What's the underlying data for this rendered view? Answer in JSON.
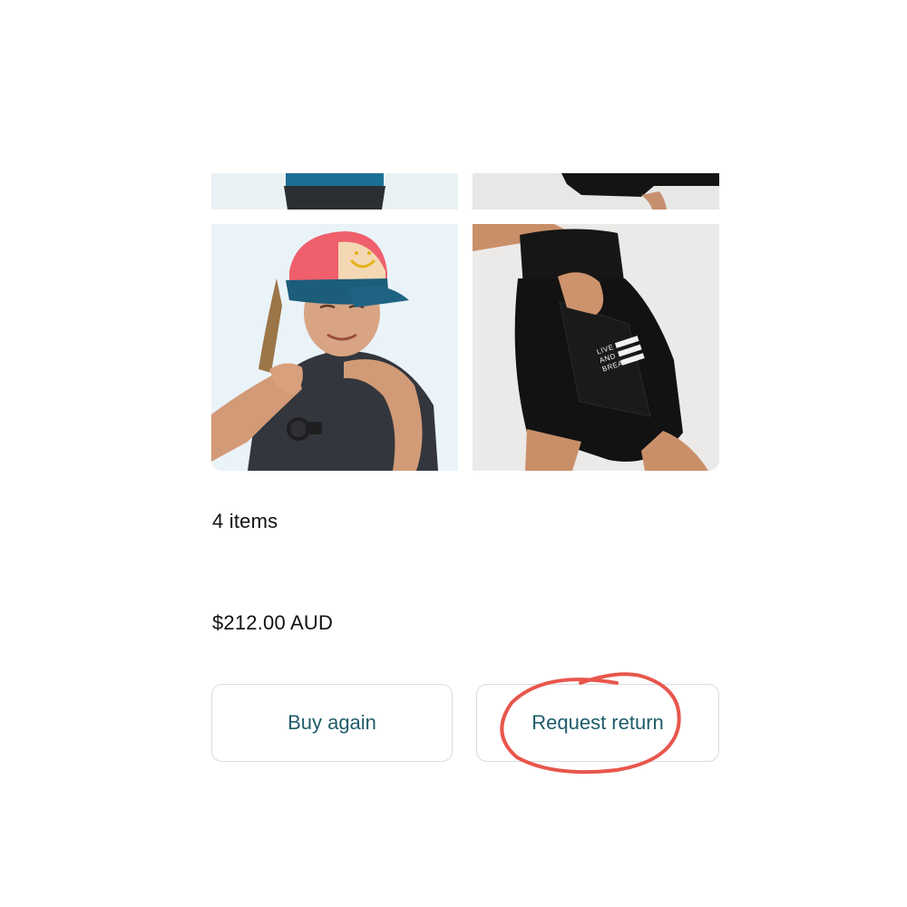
{
  "order": {
    "item_count": "4 items",
    "total": "$212.00 AUD"
  },
  "actions": {
    "buy_again_label": "Buy again",
    "request_return_label": "Request return"
  },
  "products": {
    "shorts_print": [
      "LIVE",
      "AND",
      "BREATHE"
    ]
  },
  "colors": {
    "button_text": "#1f5c6b",
    "annotation": "#e8564c"
  }
}
